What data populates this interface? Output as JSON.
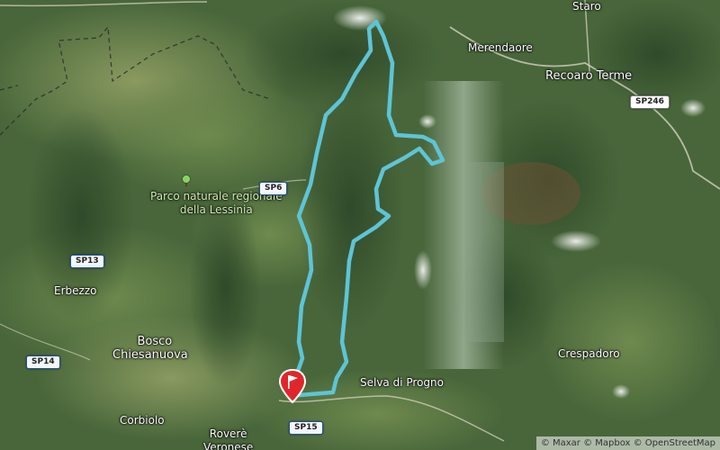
{
  "map": {
    "places": {
      "staro": "Staro",
      "merendaore": "Merendaore",
      "recoaro": "Recoaro Terme",
      "park_line1": "Parco naturale regionale",
      "park_line2": "della Lessinia",
      "erbezzo": "Erbezzo",
      "bosco_line1": "Bosco",
      "bosco_line2": "Chiesanuova",
      "selva": "Selva di Progno",
      "crespadoro": "Crespadoro",
      "corbiolo": "Corbiolo",
      "rovere_line1": "Roverè",
      "rovere_line2": "Veronese"
    },
    "roads": {
      "sp246": "SP246",
      "sp6": "SP6",
      "sp13": "SP13",
      "sp14": "SP14",
      "sp15": "SP15"
    },
    "attribution": "© Maxar © Mapbox © OpenStreetMap",
    "route_color": "#5ec4d6",
    "marker": "start-flag-icon",
    "park_icon": "tree-icon"
  }
}
